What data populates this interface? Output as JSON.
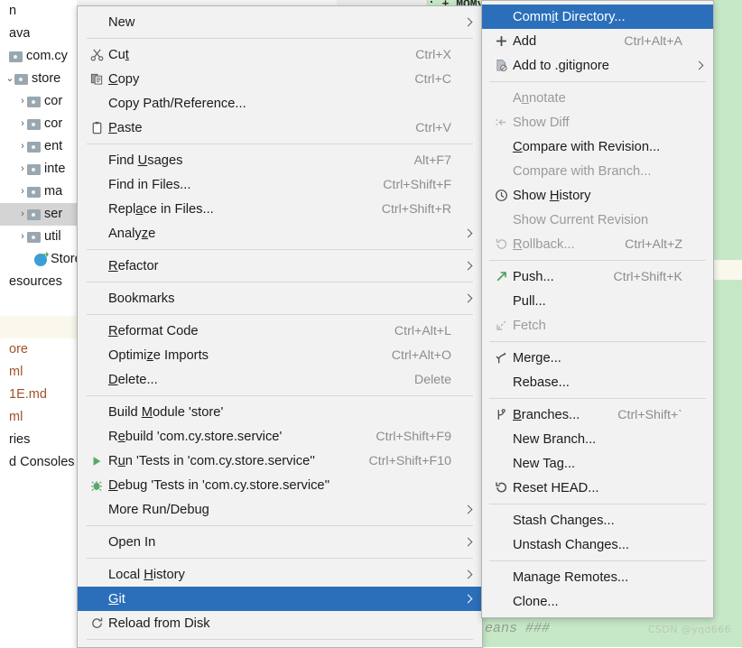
{
  "background": {
    "editor_code_text": "'eans ###",
    "tab_partial_text": ": + MOMy w",
    "watermark": "CSDN @yqd666",
    "colors": {
      "editor_green": "#c6e8c6",
      "editor_cream": "#faf8ec",
      "menu_bg": "#f2f2f2",
      "selection_blue": "#2b6fba",
      "tree_selection_gray": "#d4d4d4",
      "accel_gray": "#8c8c8c",
      "disabled_gray": "#9a9a9a",
      "file_orange": "#a0522d",
      "run_green": "#59a869"
    }
  },
  "project_tree": {
    "items": [
      {
        "label": "n",
        "indent": 0,
        "twisty": "",
        "icon": "none",
        "color": "dark",
        "selected": false,
        "band": false
      },
      {
        "label": "ava",
        "indent": 0,
        "twisty": "",
        "icon": "none",
        "color": "dark",
        "selected": false,
        "band": false
      },
      {
        "label": "com.cy",
        "indent": 0,
        "twisty": "",
        "icon": "folder",
        "color": "dark",
        "selected": false,
        "band": false
      },
      {
        "label": "store",
        "indent": 6,
        "twisty": "v",
        "icon": "folder",
        "color": "dark",
        "selected": false,
        "band": false
      },
      {
        "label": "cor",
        "indent": 20,
        "twisty": ">",
        "icon": "folder",
        "color": "dark",
        "selected": false,
        "band": false
      },
      {
        "label": "cor",
        "indent": 20,
        "twisty": ">",
        "icon": "folder",
        "color": "dark",
        "selected": false,
        "band": false
      },
      {
        "label": "ent",
        "indent": 20,
        "twisty": ">",
        "icon": "folder",
        "color": "dark",
        "selected": false,
        "band": false
      },
      {
        "label": "inte",
        "indent": 20,
        "twisty": ">",
        "icon": "folder",
        "color": "dark",
        "selected": false,
        "band": false
      },
      {
        "label": "ma",
        "indent": 20,
        "twisty": ">",
        "icon": "folder",
        "color": "dark",
        "selected": false,
        "band": false
      },
      {
        "label": "ser",
        "indent": 20,
        "twisty": ">",
        "icon": "folder",
        "color": "dark",
        "selected": true,
        "band": false
      },
      {
        "label": "util",
        "indent": 20,
        "twisty": ">",
        "icon": "folder",
        "color": "dark",
        "selected": false,
        "band": false
      },
      {
        "label": "StoreA",
        "indent": 28,
        "twisty": "",
        "icon": "class",
        "color": "dark",
        "selected": false,
        "band": false
      },
      {
        "label": "esources",
        "indent": 0,
        "twisty": "",
        "icon": "none",
        "color": "dark",
        "selected": false,
        "band": false
      },
      {
        "label": "",
        "indent": 0,
        "twisty": "",
        "icon": "none",
        "color": "dark",
        "selected": false,
        "band": false
      },
      {
        "label": "",
        "indent": 0,
        "twisty": "",
        "icon": "none",
        "color": "dark",
        "selected": false,
        "band": true
      },
      {
        "label": "ore",
        "indent": 0,
        "twisty": "",
        "icon": "none",
        "color": "orange",
        "selected": false,
        "band": false
      },
      {
        "label": "ml",
        "indent": 0,
        "twisty": "",
        "icon": "none",
        "color": "orange",
        "selected": false,
        "band": false
      },
      {
        "label": "1E.md",
        "indent": 0,
        "twisty": "",
        "icon": "none",
        "color": "orange",
        "selected": false,
        "band": false
      },
      {
        "label": "ml",
        "indent": 0,
        "twisty": "",
        "icon": "none",
        "color": "orange",
        "selected": false,
        "band": false
      },
      {
        "label": "ries",
        "indent": 0,
        "twisty": "",
        "icon": "none",
        "color": "dark",
        "selected": false,
        "band": false
      },
      {
        "label": "d Consoles",
        "indent": 0,
        "twisty": "",
        "icon": "none",
        "color": "dark",
        "selected": false,
        "band": false
      }
    ]
  },
  "context_menu": {
    "name": "file-context-menu",
    "items": [
      {
        "type": "item",
        "label": "New",
        "mnemonic": "",
        "accel": "",
        "icon": "none",
        "submenu": true,
        "disabled": false,
        "selected": false
      },
      {
        "type": "sep"
      },
      {
        "type": "item",
        "label": "Cut",
        "mnemonic": "t",
        "accel": "Ctrl+X",
        "icon": "scissors",
        "submenu": false,
        "disabled": false,
        "selected": false
      },
      {
        "type": "item",
        "label": "Copy",
        "mnemonic": "C",
        "accel": "Ctrl+C",
        "icon": "copy",
        "submenu": false,
        "disabled": false,
        "selected": false
      },
      {
        "type": "item",
        "label": "Copy Path/Reference...",
        "mnemonic": "",
        "accel": "",
        "icon": "none",
        "submenu": false,
        "disabled": false,
        "selected": false
      },
      {
        "type": "item",
        "label": "Paste",
        "mnemonic": "P",
        "accel": "Ctrl+V",
        "icon": "clipboard",
        "submenu": false,
        "disabled": false,
        "selected": false
      },
      {
        "type": "sep"
      },
      {
        "type": "item",
        "label": "Find Usages",
        "mnemonic": "U",
        "accel": "Alt+F7",
        "icon": "none",
        "submenu": false,
        "disabled": false,
        "selected": false
      },
      {
        "type": "item",
        "label": "Find in Files...",
        "mnemonic": "",
        "accel": "Ctrl+Shift+F",
        "icon": "none",
        "submenu": false,
        "disabled": false,
        "selected": false
      },
      {
        "type": "item",
        "label": "Replace in Files...",
        "mnemonic": "a",
        "accel": "Ctrl+Shift+R",
        "icon": "none",
        "submenu": false,
        "disabled": false,
        "selected": false
      },
      {
        "type": "item",
        "label": "Analyze",
        "mnemonic": "z",
        "accel": "",
        "icon": "none",
        "submenu": true,
        "disabled": false,
        "selected": false
      },
      {
        "type": "sep"
      },
      {
        "type": "item",
        "label": "Refactor",
        "mnemonic": "R",
        "accel": "",
        "icon": "none",
        "submenu": true,
        "disabled": false,
        "selected": false
      },
      {
        "type": "sep"
      },
      {
        "type": "item",
        "label": "Bookmarks",
        "mnemonic": "",
        "accel": "",
        "icon": "none",
        "submenu": true,
        "disabled": false,
        "selected": false
      },
      {
        "type": "sep"
      },
      {
        "type": "item",
        "label": "Reformat Code",
        "mnemonic": "R",
        "accel": "Ctrl+Alt+L",
        "icon": "none",
        "submenu": false,
        "disabled": false,
        "selected": false
      },
      {
        "type": "item",
        "label": "Optimize Imports",
        "mnemonic": "z",
        "accel": "Ctrl+Alt+O",
        "icon": "none",
        "submenu": false,
        "disabled": false,
        "selected": false
      },
      {
        "type": "item",
        "label": "Delete...",
        "mnemonic": "D",
        "accel": "Delete",
        "icon": "none",
        "submenu": false,
        "disabled": false,
        "selected": false
      },
      {
        "type": "sep"
      },
      {
        "type": "item",
        "label": "Build Module 'store'",
        "mnemonic": "M",
        "accel": "",
        "icon": "none",
        "submenu": false,
        "disabled": false,
        "selected": false
      },
      {
        "type": "item",
        "label": "Rebuild 'com.cy.store.service'",
        "mnemonic": "e",
        "accel": "Ctrl+Shift+F9",
        "icon": "none",
        "submenu": false,
        "disabled": false,
        "selected": false
      },
      {
        "type": "item",
        "label": "Run 'Tests in 'com.cy.store.service''",
        "mnemonic": "u",
        "accel": "Ctrl+Shift+F10",
        "icon": "run",
        "submenu": false,
        "disabled": false,
        "selected": false
      },
      {
        "type": "item",
        "label": "Debug 'Tests in 'com.cy.store.service''",
        "mnemonic": "D",
        "accel": "",
        "icon": "debug",
        "submenu": false,
        "disabled": false,
        "selected": false
      },
      {
        "type": "item",
        "label": "More Run/Debug",
        "mnemonic": "",
        "accel": "",
        "icon": "none",
        "submenu": true,
        "disabled": false,
        "selected": false
      },
      {
        "type": "sep"
      },
      {
        "type": "item",
        "label": "Open In",
        "mnemonic": "",
        "accel": "",
        "icon": "none",
        "submenu": true,
        "disabled": false,
        "selected": false
      },
      {
        "type": "sep"
      },
      {
        "type": "item",
        "label": "Local History",
        "mnemonic": "H",
        "accel": "",
        "icon": "none",
        "submenu": true,
        "disabled": false,
        "selected": false
      },
      {
        "type": "item",
        "label": "Git",
        "mnemonic": "G",
        "accel": "",
        "icon": "none",
        "submenu": true,
        "disabled": false,
        "selected": true
      },
      {
        "type": "item",
        "label": "Reload from Disk",
        "mnemonic": "",
        "accel": "",
        "icon": "reload",
        "submenu": false,
        "disabled": false,
        "selected": false
      },
      {
        "type": "sep"
      }
    ]
  },
  "git_submenu": {
    "name": "git-submenu",
    "items": [
      {
        "type": "item",
        "label": "Commit Directory...",
        "mnemonic": "i",
        "accel": "",
        "icon": "none",
        "submenu": false,
        "disabled": false,
        "selected": true
      },
      {
        "type": "item",
        "label": "Add",
        "mnemonic": "",
        "accel": "Ctrl+Alt+A",
        "icon": "plus",
        "submenu": false,
        "disabled": false,
        "selected": false
      },
      {
        "type": "item",
        "label": "Add to .gitignore",
        "mnemonic": "",
        "accel": "",
        "icon": "gitignore",
        "submenu": true,
        "disabled": false,
        "selected": false
      },
      {
        "type": "sep"
      },
      {
        "type": "item",
        "label": "Annotate",
        "mnemonic": "n",
        "accel": "",
        "icon": "none",
        "submenu": false,
        "disabled": true,
        "selected": false
      },
      {
        "type": "item",
        "label": "Show Diff",
        "mnemonic": "",
        "accel": "",
        "icon": "diff",
        "submenu": false,
        "disabled": true,
        "selected": false
      },
      {
        "type": "item",
        "label": "Compare with Revision...",
        "mnemonic": "C",
        "accel": "",
        "icon": "none",
        "submenu": false,
        "disabled": false,
        "selected": false
      },
      {
        "type": "item",
        "label": "Compare with Branch...",
        "mnemonic": "",
        "accel": "",
        "icon": "none",
        "submenu": false,
        "disabled": true,
        "selected": false
      },
      {
        "type": "item",
        "label": "Show History",
        "mnemonic": "H",
        "accel": "",
        "icon": "history",
        "submenu": false,
        "disabled": false,
        "selected": false
      },
      {
        "type": "item",
        "label": "Show Current Revision",
        "mnemonic": "",
        "accel": "",
        "icon": "none",
        "submenu": false,
        "disabled": true,
        "selected": false
      },
      {
        "type": "item",
        "label": "Rollback...",
        "mnemonic": "R",
        "accel": "Ctrl+Alt+Z",
        "icon": "rollback",
        "submenu": false,
        "disabled": true,
        "selected": false
      },
      {
        "type": "sep"
      },
      {
        "type": "item",
        "label": "Push...",
        "mnemonic": "",
        "accel": "Ctrl+Shift+K",
        "icon": "push",
        "submenu": false,
        "disabled": false,
        "selected": false
      },
      {
        "type": "item",
        "label": "Pull...",
        "mnemonic": "",
        "accel": "",
        "icon": "none",
        "submenu": false,
        "disabled": false,
        "selected": false
      },
      {
        "type": "item",
        "label": "Fetch",
        "mnemonic": "",
        "accel": "",
        "icon": "fetch",
        "submenu": false,
        "disabled": true,
        "selected": false
      },
      {
        "type": "sep"
      },
      {
        "type": "item",
        "label": "Merge...",
        "mnemonic": "",
        "accel": "",
        "icon": "merge",
        "submenu": false,
        "disabled": false,
        "selected": false
      },
      {
        "type": "item",
        "label": "Rebase...",
        "mnemonic": "",
        "accel": "",
        "icon": "none",
        "submenu": false,
        "disabled": false,
        "selected": false
      },
      {
        "type": "sep"
      },
      {
        "type": "item",
        "label": "Branches...",
        "mnemonic": "B",
        "accel": "Ctrl+Shift+`",
        "icon": "branch",
        "submenu": false,
        "disabled": false,
        "selected": false
      },
      {
        "type": "item",
        "label": "New Branch...",
        "mnemonic": "",
        "accel": "",
        "icon": "none",
        "submenu": false,
        "disabled": false,
        "selected": false
      },
      {
        "type": "item",
        "label": "New Tag...",
        "mnemonic": "",
        "accel": "",
        "icon": "none",
        "submenu": false,
        "disabled": false,
        "selected": false
      },
      {
        "type": "item",
        "label": "Reset HEAD...",
        "mnemonic": "",
        "accel": "",
        "icon": "reset",
        "submenu": false,
        "disabled": false,
        "selected": false
      },
      {
        "type": "sep"
      },
      {
        "type": "item",
        "label": "Stash Changes...",
        "mnemonic": "",
        "accel": "",
        "icon": "none",
        "submenu": false,
        "disabled": false,
        "selected": false
      },
      {
        "type": "item",
        "label": "Unstash Changes...",
        "mnemonic": "",
        "accel": "",
        "icon": "none",
        "submenu": false,
        "disabled": false,
        "selected": false
      },
      {
        "type": "sep"
      },
      {
        "type": "item",
        "label": "Manage Remotes...",
        "mnemonic": "",
        "accel": "",
        "icon": "none",
        "submenu": false,
        "disabled": false,
        "selected": false
      },
      {
        "type": "item",
        "label": "Clone...",
        "mnemonic": "",
        "accel": "",
        "icon": "none",
        "submenu": false,
        "disabled": false,
        "selected": false
      }
    ]
  }
}
